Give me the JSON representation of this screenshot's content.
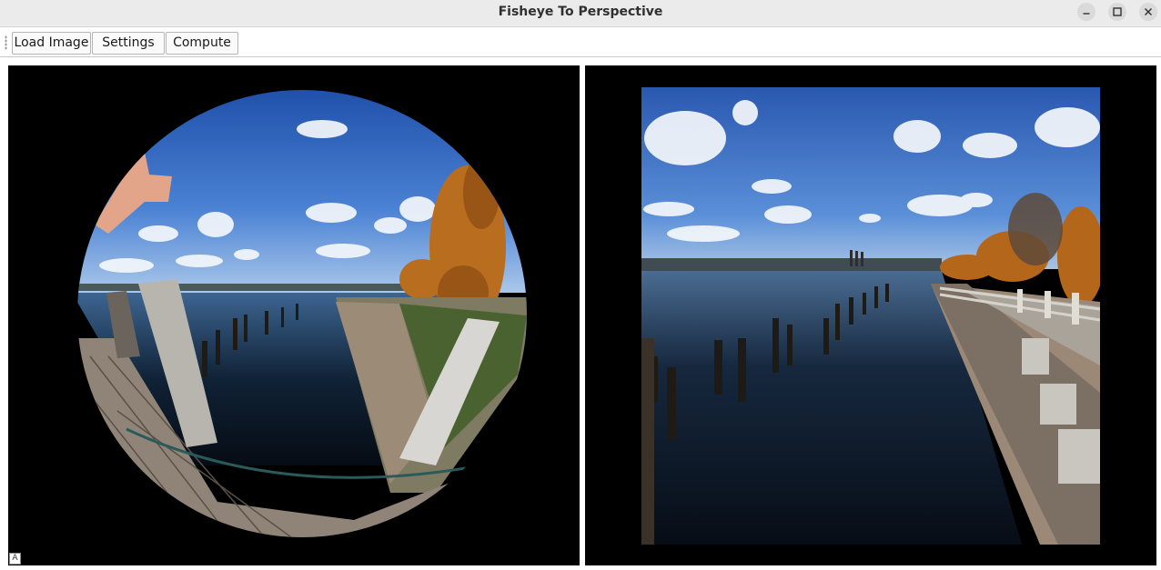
{
  "window": {
    "title": "Fisheye To Perspective",
    "controls": [
      "minimize",
      "maximize",
      "close"
    ]
  },
  "toolbar": {
    "load_image_label": "Load Image",
    "settings_label": "Settings",
    "compute_label": "Compute"
  },
  "panels": {
    "left": {
      "content": "fisheye-input-image"
    },
    "right": {
      "content": "perspective-output-image"
    }
  },
  "status": {
    "grip_glyph": "A"
  },
  "colors": {
    "titlebar": "#ebebeb",
    "panel_background": "#000000",
    "sky": "#3f73c6",
    "water": "#0c1a2c"
  }
}
